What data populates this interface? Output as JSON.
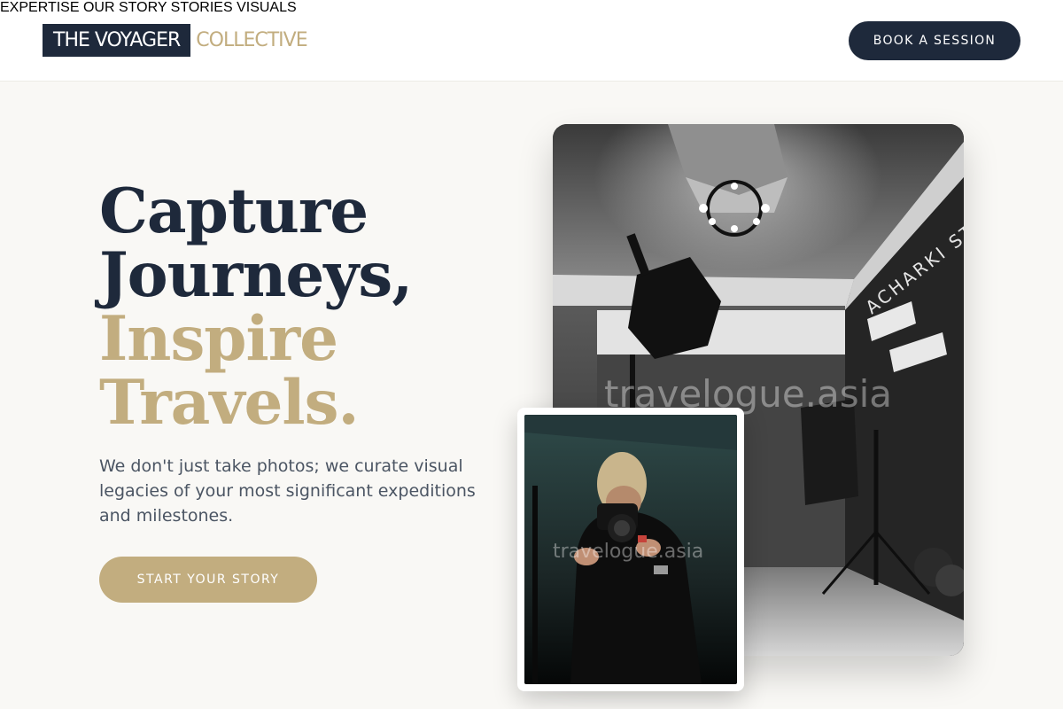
{
  "brand": {
    "primary": "THE VOYAGER",
    "accent": "COLLECTIVE"
  },
  "nav": {
    "items": [
      "EXPERTISE",
      "OUR STORY",
      "STORIES",
      "VISUALS"
    ]
  },
  "header": {
    "cta_label": "BOOK A SESSION"
  },
  "hero": {
    "headline_line1": "Capture",
    "headline_line2": "Journeys,",
    "headline_line3": "Inspire",
    "headline_line4": "Travels.",
    "lead": "We don't just take photos; we curate visual legacies of your most significant expeditions and milestones.",
    "cta_label": "START YOUR STORY"
  },
  "images": {
    "main_watermark": "travelogue.asia",
    "main_wall_text": "ACHARKI STU",
    "small_watermark": "travelogue.asia"
  },
  "colors": {
    "navy": "#1e293b",
    "gold": "#c2ad7f",
    "background": "#f9f8f5"
  }
}
